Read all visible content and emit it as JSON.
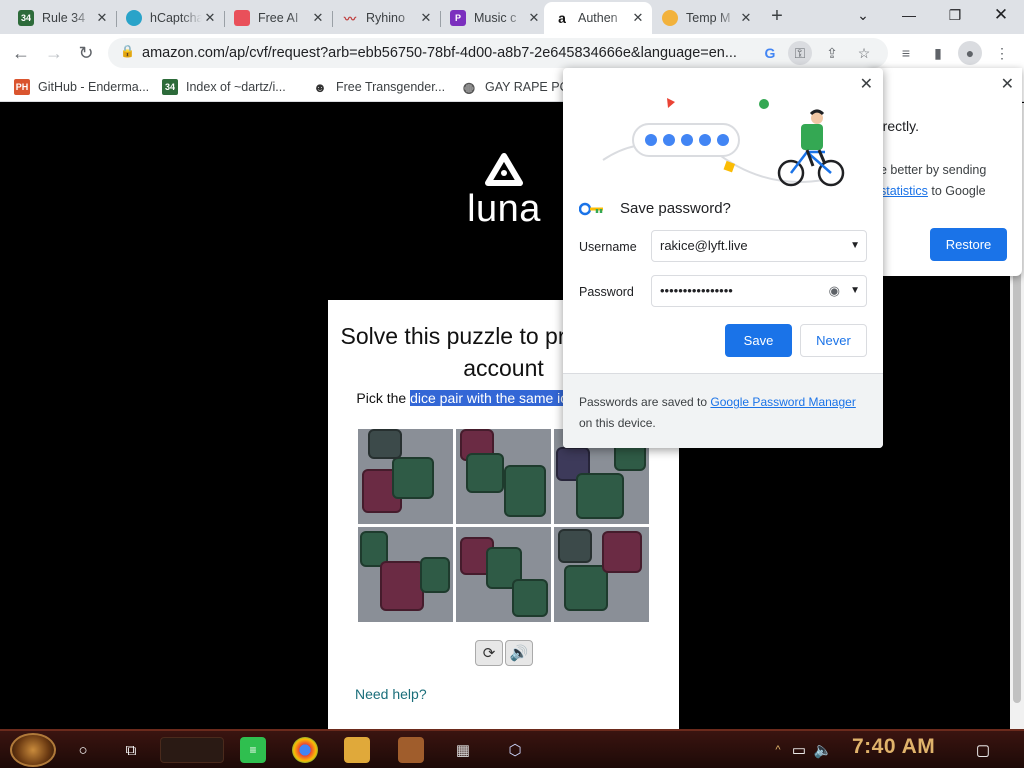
{
  "tabs": [
    {
      "title": "Rule 34",
      "active": false
    },
    {
      "title": "hCaptcha",
      "active": false
    },
    {
      "title": "Free AI",
      "active": false
    },
    {
      "title": "Ryhino",
      "active": false
    },
    {
      "title": "Music c",
      "active": false
    },
    {
      "title": "Authen",
      "active": true
    },
    {
      "title": "Temp M",
      "active": false
    }
  ],
  "toolbar": {
    "url": "amazon.com/ap/cvf/request?arb=ebb56750-78bf-4d00-a8b7-2e645834666e&language=en..."
  },
  "bookmarks": [
    {
      "label": "GitHub - Enderma...",
      "icon": "PH"
    },
    {
      "label": "Index of ~dartz/i...",
      "icon": "34"
    },
    {
      "label": "Free Transgender...",
      "icon": "mask"
    },
    {
      "label": "GAY RAPE PO",
      "icon": "globe"
    }
  ],
  "page": {
    "logo_text": "luna",
    "puzzle_title": "Solve this puzzle to protect your account",
    "instruction_prefix": "Pick the ",
    "instruction_highlight": "dice pair with the same icons facing up",
    "help_link": "Need help?"
  },
  "restore_popup": {
    "text1": "rrectly.",
    "text2": "e better by sending",
    "link": "statistics",
    "text3": " to Google",
    "button": "Restore"
  },
  "save_password": {
    "title": "Save password?",
    "username_label": "Username",
    "username_value": "rakice@lyft.live",
    "password_label": "Password",
    "password_value": "••••••••••••••••",
    "save_label": "Save",
    "never_label": "Never",
    "footer_prefix": "Passwords are saved to ",
    "footer_link": "Google Password Manager",
    "footer_suffix": "on this device."
  },
  "taskbar": {
    "clock": "7:40 AM"
  },
  "colors": {
    "accent": "#1a73e8",
    "highlight": "#3367d6"
  }
}
